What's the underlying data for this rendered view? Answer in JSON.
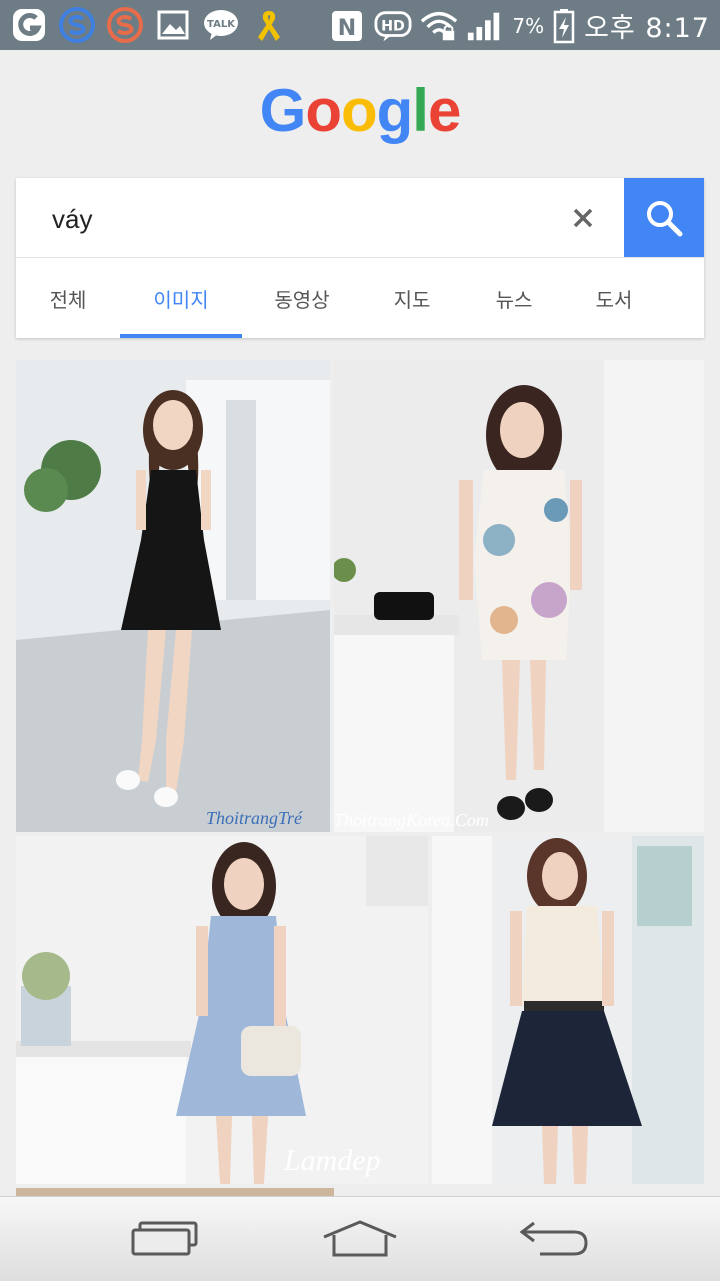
{
  "status_bar": {
    "talk_badge": "TALK",
    "nfc_badge": "N",
    "hd_badge": "HD",
    "battery_percent": "7%",
    "clock": "오후 8:17",
    "icons": [
      "g-app-icon",
      "s-app-icon-blue",
      "s-app-icon-orange",
      "gallery-icon",
      "kakaotalk-icon",
      "yellow-ribbon-icon",
      "nfc-icon",
      "hd-voice-icon",
      "wifi-locked-icon",
      "signal-icon",
      "battery-charging-icon"
    ]
  },
  "logo": {
    "letters": [
      {
        "char": "G",
        "color": "#4285F4"
      },
      {
        "char": "o",
        "color": "#EA4335"
      },
      {
        "char": "o",
        "color": "#FBBC05"
      },
      {
        "char": "g",
        "color": "#4285F4"
      },
      {
        "char": "l",
        "color": "#34A853"
      },
      {
        "char": "e",
        "color": "#EA4335"
      }
    ]
  },
  "search": {
    "query": "váy",
    "clear_icon": "close-icon",
    "search_icon": "search-icon",
    "accent": "#4285F4"
  },
  "tabs": [
    {
      "label": "전체",
      "active": false
    },
    {
      "label": "이미지",
      "active": true
    },
    {
      "label": "동영상",
      "active": false
    },
    {
      "label": "지도",
      "active": false
    },
    {
      "label": "뉴스",
      "active": false
    },
    {
      "label": "도서",
      "active": false
    }
  ],
  "results": [
    {
      "watermark": "ThoitrangTré"
    },
    {
      "watermark": "ThoitrangKorea.Com"
    },
    {
      "watermark": "Lamdep"
    },
    {
      "watermark": ""
    }
  ],
  "nav_bar": {
    "icons": [
      "recent-apps-icon",
      "home-icon",
      "back-icon"
    ]
  }
}
